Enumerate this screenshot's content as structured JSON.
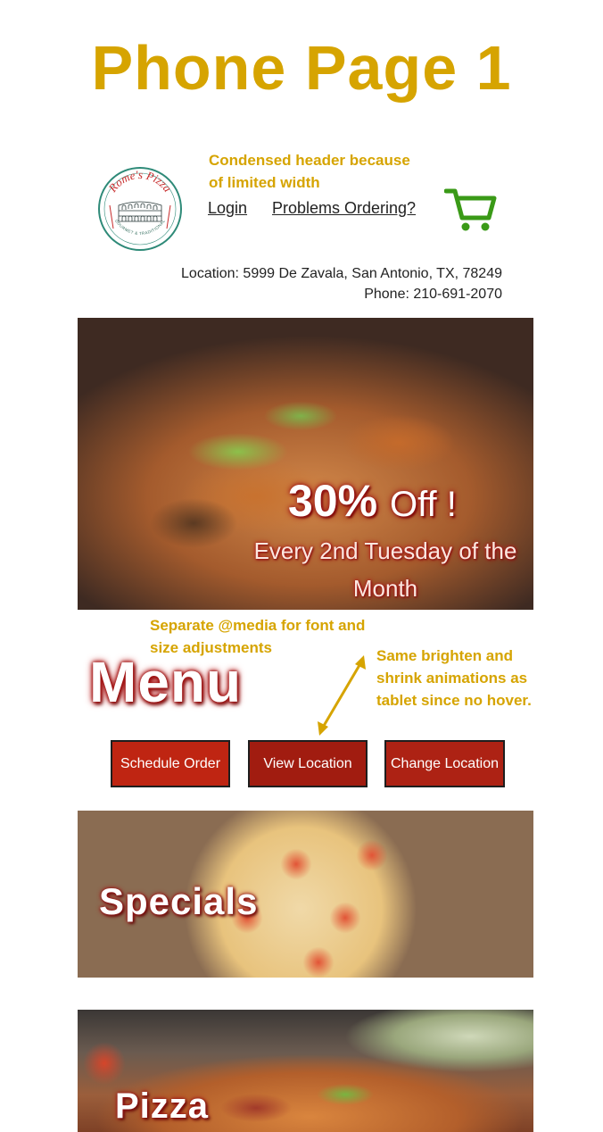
{
  "page": {
    "title": "Phone Page 1"
  },
  "annotations": {
    "header_note": "Condensed header because of limited width",
    "media_note": "Separate @media for font and size adjustments",
    "animation_note": "Same brighten and shrink animations as tablet since no hover."
  },
  "header": {
    "logo_text": "Rome's Pizza",
    "logo_tagline": "GOURMET & TRADITIONAL",
    "nav": {
      "login": "Login",
      "problems": "Problems Ordering?"
    },
    "cart_icon": "shopping-cart-icon",
    "location": "Location: 5999 De Zavala, San Antonio, TX, 78249",
    "phone": "Phone: 210-691-2070"
  },
  "hero": {
    "headline": "30%",
    "headline_suffix": "Off !",
    "subline": "Every 2nd Tuesday of the Month"
  },
  "menu": {
    "heading": "Menu",
    "buttons": {
      "schedule": "Schedule Order",
      "view": "View Location",
      "change": "Change Location"
    }
  },
  "categories": {
    "specials": "Specials",
    "pizza": "Pizza"
  },
  "colors": {
    "annotation": "#d6a400",
    "button": "#b52414",
    "cart": "#3a9a17",
    "logo": "#c72b2b"
  }
}
